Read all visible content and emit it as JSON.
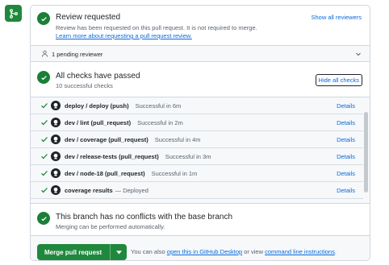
{
  "review": {
    "title": "Review requested",
    "description": "Review has been requested on this pull request. It is not required to merge.",
    "learn_more": "Learn more about requesting a pull request review.",
    "show_all": "Show all reviewers"
  },
  "pending": {
    "label": "1 pending reviewer"
  },
  "checks": {
    "title": "All checks have passed",
    "subtitle": "10 successful checks",
    "hide_all": "Hide all checks",
    "rows": [
      {
        "name": "deploy / deploy (push)",
        "status": "Successful in 6m",
        "details": "Details"
      },
      {
        "name": "dev / lint (pull_request)",
        "status": "Successful in 2m",
        "details": "Details"
      },
      {
        "name": "dev / coverage (pull_request)",
        "status": "Successful in 4m",
        "details": "Details"
      },
      {
        "name": "dev / release-tests (pull_request)",
        "status": "Successful in 3m",
        "details": "Details"
      },
      {
        "name": "dev / node-18 (pull_request)",
        "status": "Successful in 1m",
        "details": "Details"
      },
      {
        "name": "coverage results",
        "status": "— Deployed",
        "details": "Details"
      }
    ]
  },
  "conflicts": {
    "title": "This branch has no conflicts with the base branch",
    "subtitle": "Merging can be performed automatically."
  },
  "merge": {
    "button_label": "Merge pull request",
    "hint_prefix": "You can also",
    "hint_link1": "open this in GitHub Desktop",
    "hint_middle": "or view",
    "hint_link2": "command line instructions",
    "hint_suffix": "."
  },
  "colors": {
    "success": "#1a7f37",
    "merge_button": "#1f883d",
    "link": "#0969da"
  }
}
